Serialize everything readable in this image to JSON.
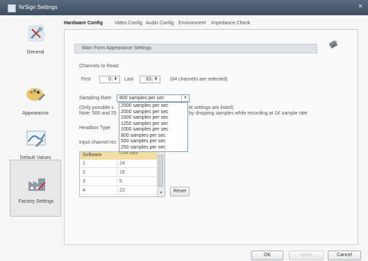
{
  "window": {
    "title": "NrSign Settings",
    "close_glyph": "×"
  },
  "sidebar": {
    "items": [
      {
        "label": "General",
        "icon": "tools-icon"
      },
      {
        "label": "Appearance",
        "icon": "paint-palette-icon"
      },
      {
        "label": "Default Values",
        "icon": "chart-icon"
      },
      {
        "label": "Factory Settings",
        "icon": "factory-icon",
        "selected": true
      }
    ]
  },
  "tabs": [
    {
      "label": "Hardware Config",
      "active": true
    },
    {
      "label": "Video Config"
    },
    {
      "label": "Audio Config"
    },
    {
      "label": "Environment"
    },
    {
      "label": "Impedance Check"
    }
  ],
  "main": {
    "section_title": "Main Form Appearance Settings",
    "channels_label": "Channels to Read:",
    "first_label": "First",
    "first_value": "0",
    "last_label": "Last",
    "last_value": "63",
    "channels_note": "(64 channels are selected)",
    "sampling_label": "Sampling Rate:",
    "sampling_value": "800 samples per sec",
    "sampling_options": [
      "2500  samples per sec",
      "2000  samples per sec",
      "1600  samples per sec",
      "1250  samples per sec",
      "1000  samples per sec",
      "800  samples per sec",
      "500  samples per sec",
      "250  samples per sec"
    ],
    "note_line1_a": "(Only possible s",
    "note_line1_b": "el settings are listed)",
    "note_line2_a": "Note: 500 and 25",
    "note_line2_b": "by dropping samples while recording at 1K sample rate.",
    "headbox_label": "Headbox Type",
    "input_channel_label": "Input channel rec",
    "table": {
      "headers": [
        "Software",
        "USB input"
      ],
      "rows": [
        [
          "1",
          "24"
        ],
        [
          "2",
          "16"
        ],
        [
          "3",
          "5"
        ],
        [
          "4",
          "22"
        ]
      ]
    },
    "reset_label": "Reset"
  },
  "footer": {
    "ok_label": "OK",
    "apply_label": "Apply",
    "cancel_label": "Cancel"
  },
  "colors": {
    "titlebar": "#4a5a6e",
    "table_header": "#f2dea0",
    "header_bar": "#dfe2e6"
  }
}
